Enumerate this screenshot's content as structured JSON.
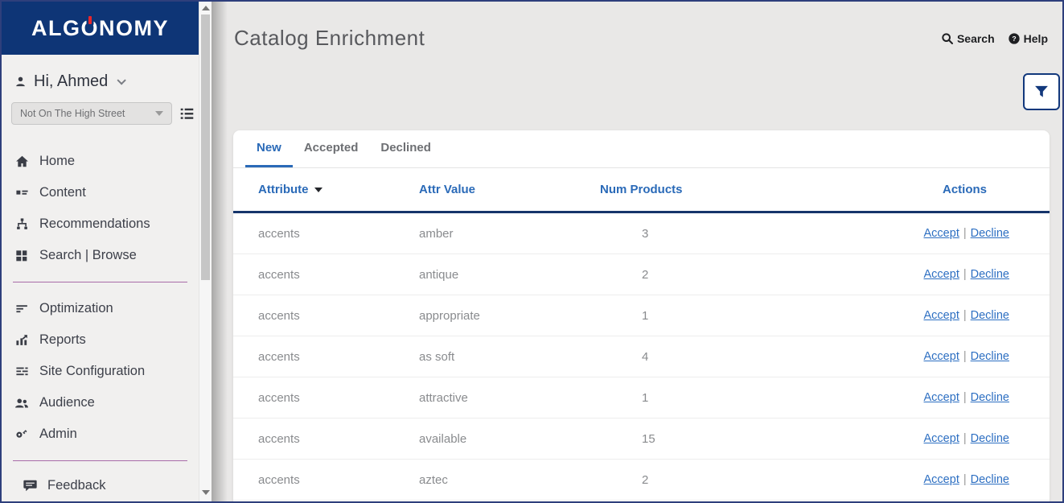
{
  "brand": {
    "pre": "ALG",
    "power_letter": "O",
    "post": "NOMY",
    "full_name": "ALGONOMY"
  },
  "sidebar": {
    "greeting": "Hi, Ahmed",
    "site_selector": {
      "value": "Not On The High Street"
    },
    "nav_primary": [
      {
        "icon": "home-icon",
        "label": "Home"
      },
      {
        "icon": "content-icon",
        "label": "Content"
      },
      {
        "icon": "recommendations-icon",
        "label": "Recommendations"
      },
      {
        "icon": "search-browse-icon",
        "label": "Search | Browse"
      }
    ],
    "nav_secondary": [
      {
        "icon": "optimization-icon",
        "label": "Optimization"
      },
      {
        "icon": "reports-icon",
        "label": "Reports"
      },
      {
        "icon": "site-configuration-icon",
        "label": "Site Configuration"
      },
      {
        "icon": "audience-icon",
        "label": "Audience"
      },
      {
        "icon": "admin-icon",
        "label": "Admin"
      }
    ],
    "nav_footer": [
      {
        "icon": "feedback-icon",
        "label": "Feedback"
      }
    ]
  },
  "header": {
    "title": "Catalog Enrichment",
    "search_label": "Search",
    "help_label": "Help"
  },
  "tabs": [
    {
      "label": "New",
      "active": true
    },
    {
      "label": "Accepted",
      "active": false
    },
    {
      "label": "Declined",
      "active": false
    }
  ],
  "table": {
    "columns": {
      "attribute": "Attribute",
      "attr_value": "Attr Value",
      "num_products": "Num Products",
      "actions": "Actions"
    },
    "rows": [
      {
        "attribute": "accents",
        "attr_value": "amber",
        "num_products": "3"
      },
      {
        "attribute": "accents",
        "attr_value": "antique",
        "num_products": "2"
      },
      {
        "attribute": "accents",
        "attr_value": "appropriate",
        "num_products": "1"
      },
      {
        "attribute": "accents",
        "attr_value": "as soft",
        "num_products": "4"
      },
      {
        "attribute": "accents",
        "attr_value": "attractive",
        "num_products": "1"
      },
      {
        "attribute": "accents",
        "attr_value": "available",
        "num_products": "15"
      },
      {
        "attribute": "accents",
        "attr_value": "aztec",
        "num_products": "2"
      }
    ],
    "actions": {
      "accept": "Accept",
      "separator": "|",
      "decline": "Decline"
    }
  },
  "colors": {
    "logo_navy": "#0e3576",
    "logo_red": "#e8262b",
    "accent_blue": "#2a6ab8",
    "header_rule_navy": "#16356b",
    "link_blue": "#2d6fc2",
    "divider_purple": "#a86ba8",
    "filter_border_navy": "#12387c"
  }
}
